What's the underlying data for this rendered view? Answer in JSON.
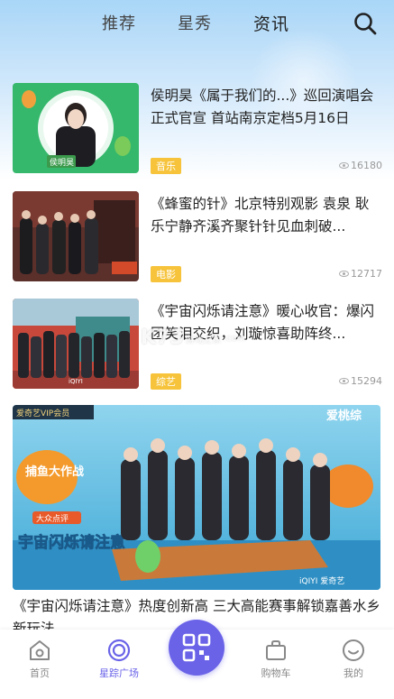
{
  "header": {
    "tabs": [
      {
        "label": "推荐",
        "active": false
      },
      {
        "label": "星秀",
        "active": false
      },
      {
        "label": "资讯",
        "active": true
      }
    ],
    "search_icon": "search-icon"
  },
  "news": [
    {
      "title": "侯明昊《属于我们的...》巡回演唱会正式官宣 首站南京定档5月16日",
      "tag": "音乐",
      "views": "16180",
      "thumb_caption": "侯明昊"
    },
    {
      "title": "《蜂蜜的针》北京特别观影 袁泉 耿乐宁静齐溪齐聚针针见血刺破...",
      "tag": "电影",
      "views": "12717"
    },
    {
      "title": "《宇宙闪烁请注意》暖心收官：爆闪团笑泪交织，刘璇惊喜助阵终...",
      "tag": "综艺",
      "views": "15294"
    }
  ],
  "featured": {
    "title": "《宇宙闪烁请注意》热度创新高 三大高能赛事解锁嘉善水乡新玩法",
    "poster_text": {
      "top_left": "爱奇艺VIP会员",
      "top_right": "爱桃综",
      "left_title_top": "捕鱼大作战",
      "left_title_main": "宇宙闪烁请注意",
      "sponsor": "大众点评",
      "bottom_right": "iQIYI 爱奇艺"
    }
  },
  "watermark": {
    "main": "K73",
    "sub": "游戏之家",
    "domain": ".com"
  },
  "bottom_nav": {
    "home": "首页",
    "square": "星踪广场",
    "cart": "购物车",
    "mine": "我的"
  },
  "colors": {
    "accent": "#6a63e8",
    "tag": "#f6c33b",
    "sky": "#a9d6f7"
  }
}
